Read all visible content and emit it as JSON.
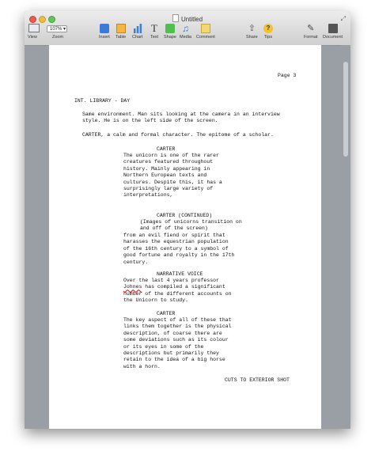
{
  "window": {
    "title": "Untitled"
  },
  "toolbar": {
    "view_label": "View",
    "zoom_value": "107%",
    "zoom_label": "Zoom",
    "insert_label": "Insert",
    "table_label": "Table",
    "chart_label": "Chart",
    "text_label": "Text",
    "shape_label": "Shape",
    "media_label": "Media",
    "comment_label": "Comment",
    "share_label": "Share",
    "tips_label": "Tips",
    "format_label": "Format",
    "document_label": "Document"
  },
  "document": {
    "page_number": "Page 3",
    "scene_heading": "INT. LIBRARY - DAY",
    "action_1": "Same environment. Man sits looking at the camera in an interview\nstyle. He is on the left side of the screen.",
    "action_2": "CARTER, a calm and formal character. The epitome of a scholar.",
    "char_1": "CARTER",
    "dialogue_1": "The unicorn is one of the rarer\ncreatures featured throughout\nhistory. Mainly appearing in\nNorthern European texts and\ncultures. Despite this, it has a\nsurprisingly large variety of\ninterpretations,",
    "char_2": "CARTER (CONTINUED)",
    "paren_2": "(Images of unicorns transition on\nand off of the screen)",
    "dialogue_2": "from an evil fiend or spirit that\nharasses the equestrian population\nof the 16th century to a symbol of\ngood fortune and royalty in the 17th\ncentury.",
    "char_3": "NARRATIVE VOICE",
    "dialogue_3a": "Over the last 4 years professor",
    "dialogue_3_name": "Johnes",
    "dialogue_3b": " has compiled a significant\nnumber of the different accounts on\nthe Unicorn to study.",
    "char_4": "CARTER",
    "dialogue_4": "The key aspect of all of these that\nlinks them together is the physical\ndescription, of coarse there are\nsome deviations such as its colour\nor its eyes in some of the\ndescriptions but primarily they\nretain to the idea of a big horse\nwith a horn.",
    "transition": "CUTS TO EXTERIOR SHOT"
  }
}
